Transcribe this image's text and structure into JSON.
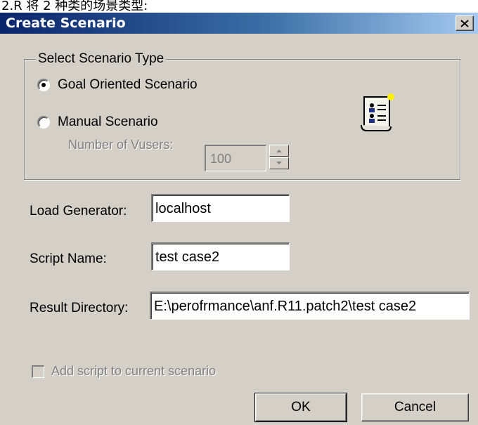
{
  "caption_strip": {
    "text": "2.R 将 2 种类的场景类型:"
  },
  "dialog": {
    "title": "Create Scenario",
    "close_icon": "close-icon",
    "scenario_type_group": {
      "legend": "Select Scenario Type",
      "options": [
        {
          "label": "Goal Oriented Scenario",
          "checked": true
        },
        {
          "label": "Manual Scenario",
          "checked": false
        }
      ],
      "vusers_label": "Number of Vusers:",
      "vusers_value": "100",
      "icon": "scenario-scroll-icon"
    },
    "fields": {
      "load_generator": {
        "label": "Load Generator:",
        "value": "localhost"
      },
      "script_name": {
        "label": "Script Name:",
        "value": "test case2"
      },
      "result_directory": {
        "label": "Result Directory:",
        "value": "E:\\perofrmance\\anf.R11.patch2\\test case2"
      }
    },
    "add_script_checkbox": {
      "label": "Add script to current scenario",
      "checked": false,
      "enabled": false
    },
    "buttons": {
      "ok": "OK",
      "cancel": "Cancel"
    }
  },
  "colors": {
    "dialog_face": "#d4d0c8",
    "title_gradient_start": "#0a246a",
    "title_gradient_end": "#a6caf0",
    "disabled_text": "#808080"
  }
}
